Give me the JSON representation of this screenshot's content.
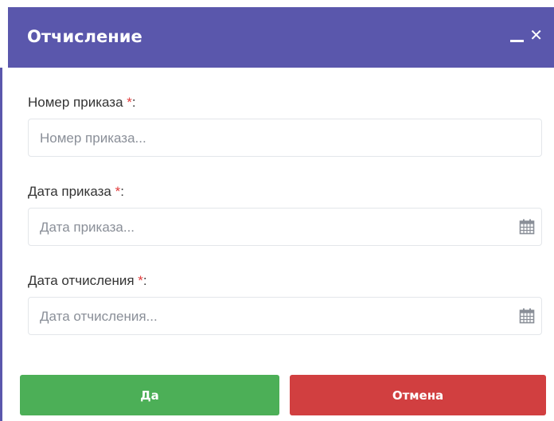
{
  "dialog": {
    "title": "Отчисление",
    "header_color": "#5a57ac",
    "controls": {
      "minimize_icon": "minimize-icon",
      "close_icon": "close-icon",
      "close_glyph": "✕"
    }
  },
  "form": {
    "fields": [
      {
        "label": "Номер приказа ",
        "required_mark": "*",
        "suffix": ":",
        "placeholder": "Номер приказа...",
        "icon": null
      },
      {
        "label": "Дата приказа ",
        "required_mark": "*",
        "suffix": ":",
        "placeholder": "Дата приказа...",
        "icon": "calendar-icon"
      },
      {
        "label": "Дата отчисления ",
        "required_mark": "*",
        "suffix": ":",
        "placeholder": "Дата отчисления...",
        "icon": "calendar-icon"
      }
    ]
  },
  "buttons": {
    "yes_label": "Да",
    "cancel_label": "Отмена",
    "yes_color": "#4caf57",
    "cancel_color": "#d13f40"
  }
}
